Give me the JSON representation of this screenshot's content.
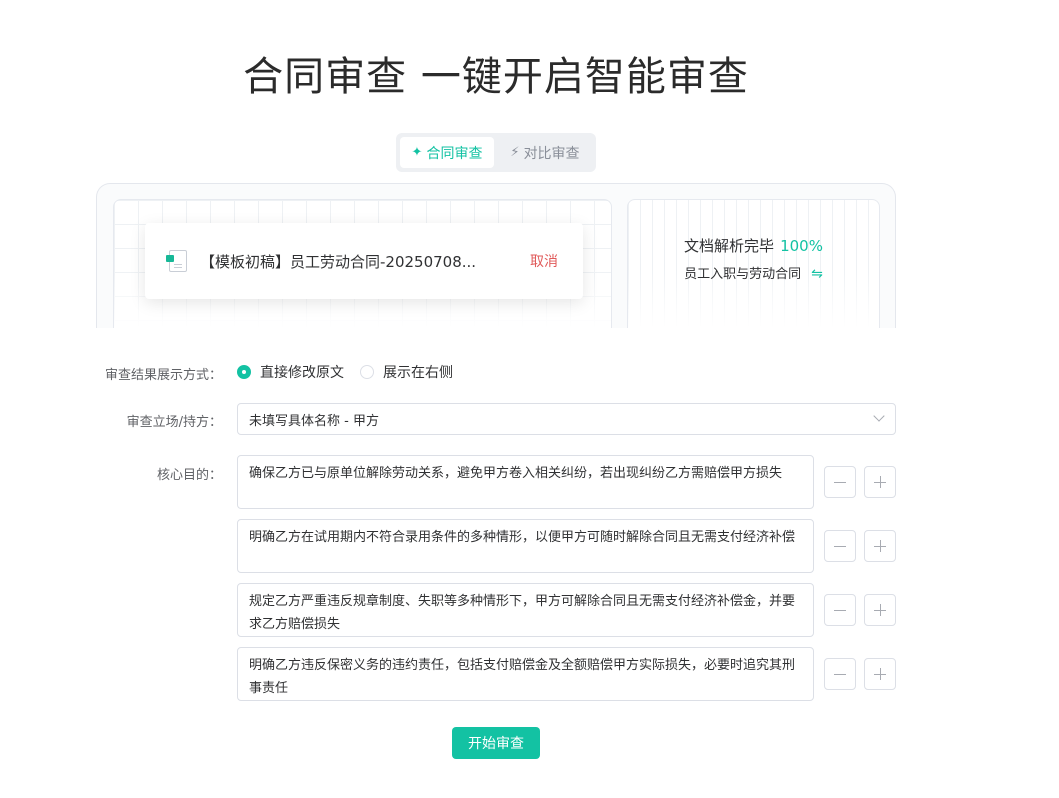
{
  "page": {
    "title": "合同审查  一键开启智能审查",
    "accent_color": "#13c2a3"
  },
  "tabs": [
    {
      "label": "合同审查",
      "icon": "sparkle-icon",
      "active": true
    },
    {
      "label": "对比审查",
      "icon": "lightning-icon",
      "active": false
    }
  ],
  "upload": {
    "file_name": "【模板初稿】员工劳动合同-20250708...",
    "file_icon": "document-icon",
    "cancel_label": "取消"
  },
  "parse": {
    "status_text": "文档解析完毕",
    "percent": "100%",
    "doc_type": "员工入职与劳动合同",
    "swap_icon": "⇋"
  },
  "form": {
    "display_mode_label": "审查结果展示方式：",
    "display_options": [
      {
        "label": "直接修改原文",
        "checked": true
      },
      {
        "label": "展示在右侧",
        "checked": false
      }
    ],
    "stance_label": "审查立场/持方：",
    "stance_value": "未填写具体名称 - 甲方",
    "goals_label": "核心目的：",
    "goals": [
      "确保乙方已与原单位解除劳动关系，避免甲方卷入相关纠纷，若出现纠纷乙方需赔偿甲方损失",
      "明确乙方在试用期内不符合录用条件的多种情形，以便甲方可随时解除合同且无需支付经济补偿",
      "规定乙方严重违反规章制度、失职等多种情形下，甲方可解除合同且无需支付经济补偿金，并要求乙方赔偿损失",
      "明确乙方违反保密义务的违约责任，包括支付赔偿金及全额赔偿甲方实际损失，必要时追究其刑事责任"
    ]
  },
  "start_label": "开始审查"
}
